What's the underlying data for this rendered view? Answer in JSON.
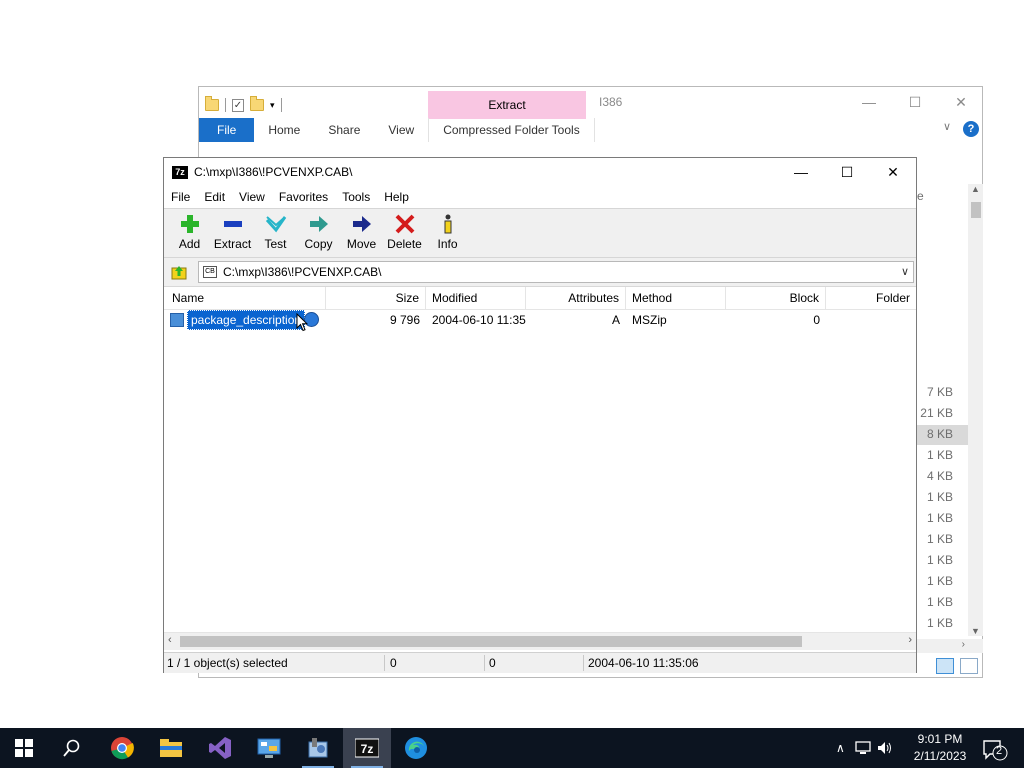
{
  "explorer": {
    "extract_tab": "Extract",
    "title": "I386",
    "ribbon_tabs": [
      "File",
      "Home",
      "Share",
      "View",
      "Compressed Folder Tools"
    ],
    "sizes": [
      "7 KB",
      "21 KB",
      "8 KB",
      "1 KB",
      "4 KB",
      "1 KB",
      "1 KB",
      "1 KB",
      "1 KB",
      "1 KB",
      "1 KB",
      "1 KB"
    ],
    "right_label": "e"
  },
  "sevenzip": {
    "title": "C:\\mxp\\I386\\!PCVENXP.CAB\\",
    "menu": [
      "File",
      "Edit",
      "View",
      "Favorites",
      "Tools",
      "Help"
    ],
    "toolbar": {
      "add": "Add",
      "extract": "Extract",
      "test": "Test",
      "copy": "Copy",
      "move": "Move",
      "delete": "Delete",
      "info": "Info"
    },
    "path": "C:\\mxp\\I386\\!PCVENXP.CAB\\",
    "columns": {
      "name": "Name",
      "size": "Size",
      "modified": "Modified",
      "attributes": "Attributes",
      "method": "Method",
      "block": "Block",
      "folder": "Folder"
    },
    "row": {
      "name": "package_description",
      "size": "9 796",
      "modified": "2004-06-10 11:35",
      "attributes": "A",
      "method": "MSZip",
      "block": "0"
    },
    "status": {
      "selected": "1 / 1 object(s) selected",
      "size": "0",
      "packed": "0",
      "date": "2004-06-10 11:35:06"
    }
  },
  "taskbar": {
    "time": "9:01 PM",
    "date": "2/11/2023",
    "notifications": "2",
    "apps": [
      "start",
      "search",
      "chrome",
      "file-explorer",
      "visual-studio",
      "control-panel",
      "tools",
      "7zip",
      "edge"
    ]
  }
}
